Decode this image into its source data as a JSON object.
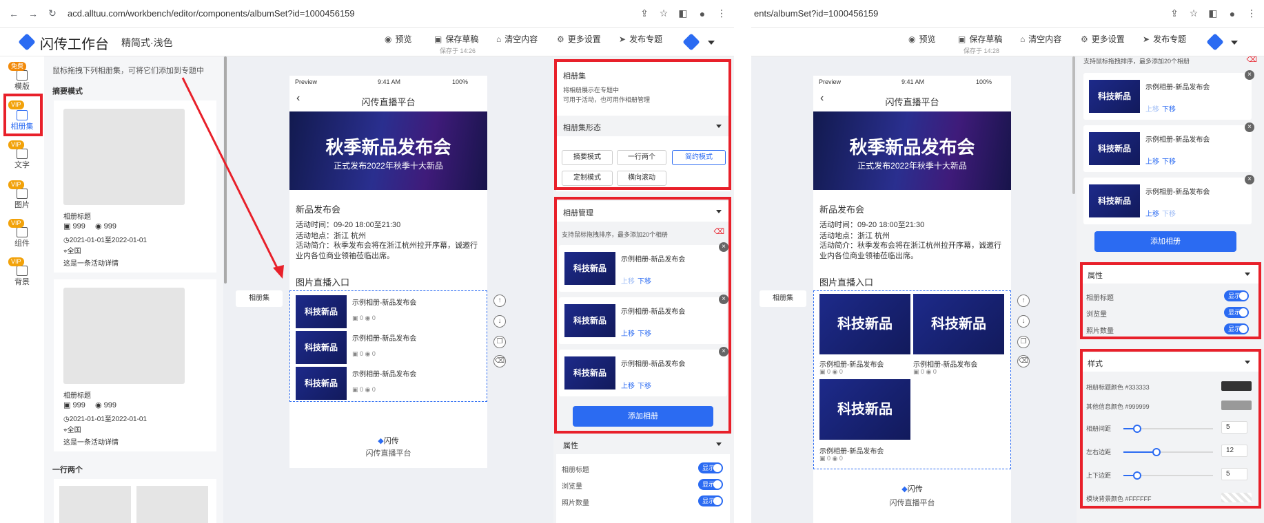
{
  "browser": {
    "url_left": "acd.alltuu.com/workbench/editor/components/albumSet?id=1000456159",
    "url_right": "ents/albumSet?id=1000456159"
  },
  "app": {
    "logo_text": "闪传工作台",
    "theme": "精简式·浅色"
  },
  "toolbar": {
    "preview": "预览",
    "save_draft": "保存草稿",
    "saved_left": "保存于 14:26",
    "saved_right": "保存于 14:28",
    "clear": "清空内容",
    "more_settings": "更多设置",
    "publish": "发布专题"
  },
  "rail": [
    {
      "label": "模版",
      "badge": "免费",
      "icon": "template-icon"
    },
    {
      "label": "相册集",
      "badge": "VIP",
      "icon": "album-icon",
      "active": true
    },
    {
      "label": "文字",
      "badge": "VIP",
      "icon": "text-icon"
    },
    {
      "label": "图片",
      "badge": "VIP",
      "icon": "image-icon"
    },
    {
      "label": "组件",
      "badge": "VIP",
      "icon": "puzzle-icon"
    },
    {
      "label": "背景",
      "badge": "VIP",
      "icon": "background-icon"
    }
  ],
  "library": {
    "hint": "鼠标拖拽下列相册集，可将它们添加到专题中",
    "mode_summary": "摘要模式",
    "mode_two": "一行两个",
    "cards": [
      {
        "title": "相册标题",
        "photos": "999",
        "views": "999",
        "date": "2021-01-01至2022-01-01",
        "location": "全国",
        "desc": "这是一条活动详情"
      },
      {
        "title": "相册标题",
        "photos": "999",
        "views": "999",
        "date": "2021-01-01至2022-01-01",
        "location": "全国",
        "desc": "这是一条活动详情"
      }
    ]
  },
  "phone": {
    "status_left": "Preview",
    "time": "9:41 AM",
    "battery": "100%",
    "title": "闪传直播平台",
    "banner_title": "秋季新品发布会",
    "banner_sub": "正式发布2022年秋季十大新品",
    "event_title": "新品发布会",
    "event_time": "活动时间：09-20 18:00至21:30",
    "event_place": "活动地点：浙江 杭州",
    "event_intro": "活动简介：秋季发布会将在浙江杭州拉开序幕，诚邀行业内各位商业领袖莅临出席。",
    "section_title": "图片直播入口",
    "album_name": "示例相册-新品发布会",
    "thumb_text": "科技新品",
    "count": "0",
    "footer_logo": "闪传",
    "footer": "闪传直播平台"
  },
  "canvas_label": "相册集",
  "settings": {
    "albumset_title": "相册集",
    "albumset_desc1": "将相册展示在专题中",
    "albumset_desc2": "可用于活动，也可用作相册管理",
    "form_label": "相册集形态",
    "modes": [
      "摘要模式",
      "一行两个",
      "简约模式",
      "定制模式",
      "横向滚动"
    ],
    "manage_title": "相册管理",
    "manage_hint": "支持鼠标拖拽排序，最多添加20个相册",
    "move_up": "上移",
    "move_down": "下移",
    "add_album": "添加相册",
    "attr_title": "属性",
    "attr_rows": [
      "相册标题",
      "浏览量",
      "照片数量"
    ],
    "toggle_on": "显示",
    "style_title": "样式",
    "style_title_color": "相册标题颜色",
    "style_title_color_val": "#333333",
    "style_other_color": "其他信息颜色",
    "style_other_color_val": "#999999",
    "style_gap": "相册间距",
    "style_gap_val": "5",
    "style_lr": "左右边距",
    "style_lr_val": "12",
    "style_tb": "上下边距",
    "style_tb_val": "5",
    "style_bg": "模块背景颜色",
    "style_bg_val": "#FFFFFF",
    "colors": {
      "accent": "#2b6bf2",
      "highlight": "#e8202a",
      "vip": "#f2a20a",
      "title_swatch": "#333333",
      "other_swatch": "#999999"
    }
  }
}
